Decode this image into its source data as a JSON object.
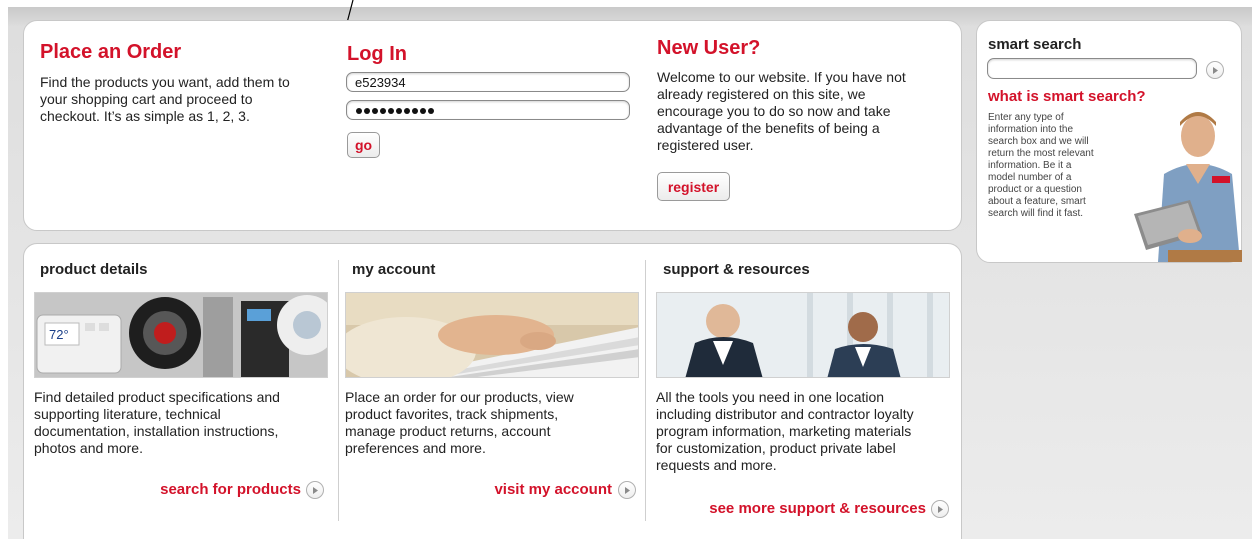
{
  "place_order": {
    "title": "Place an Order",
    "text_lines": [
      "Find the products you want, add them to",
      "your shopping cart and proceed to",
      "checkout. It’s as simple as 1, 2, 3."
    ]
  },
  "login": {
    "title": "Log In",
    "username_value": "e523934",
    "password_value": "••••••••••",
    "go_label": "go"
  },
  "new_user": {
    "title": "New User?",
    "text_lines": [
      "Welcome to our website. If you have not",
      "already registered on this site, we",
      "encourage you to do so now and take",
      "advantage of the benefits of being a",
      "registered user."
    ],
    "register_label": "register"
  },
  "smart_search": {
    "title": "smart search",
    "input_value": "",
    "subtitle": "what is smart search?",
    "text_lines": [
      "Enter any type of",
      "information into the",
      "search box and we will",
      "return the most relevant",
      "information. Be it a",
      "model number of a",
      "product or a question",
      "about a feature, smart",
      "search will find it fast."
    ]
  },
  "columns": [
    {
      "title": "product details",
      "text_lines": [
        "Find detailed product specifications and",
        "supporting literature, technical",
        "documentation, installation instructions,",
        "photos and more."
      ],
      "link": "search for products",
      "thermostat_reading": "72°"
    },
    {
      "title": "my account",
      "text_lines": [
        "Place an order for our products, view",
        "product favorites, track shipments,",
        "manage product returns, account",
        "preferences and more."
      ],
      "link": "visit my account"
    },
    {
      "title": "support & resources",
      "text_lines": [
        "All the tools you need in one location",
        "including distributor and contractor loyalty",
        "program information, marketing materials",
        "for customization, product private label",
        "requests and more."
      ],
      "link": "see more support & resources"
    }
  ],
  "colors": {
    "accent": "#d3122a",
    "text": "#222222",
    "panel_border": "#c8c8c8"
  }
}
